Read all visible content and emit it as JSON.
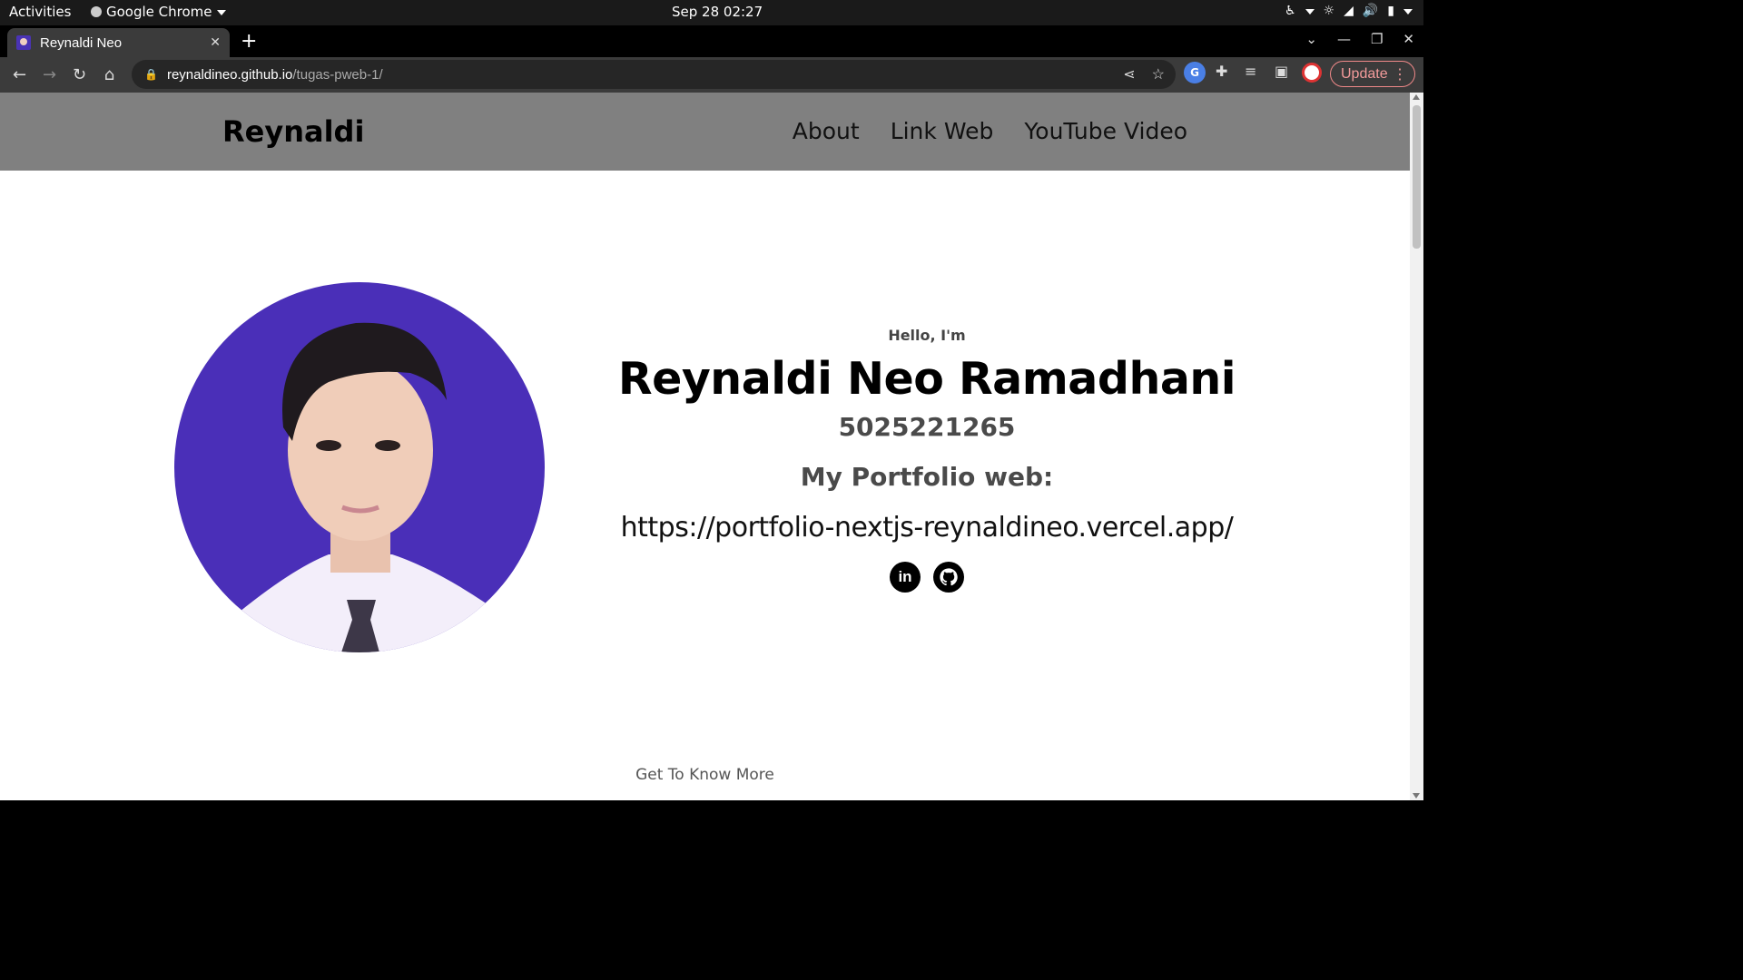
{
  "system_bar": {
    "activities": "Activities",
    "app_name": "Google Chrome",
    "clock": "Sep 28  02:27"
  },
  "browser": {
    "tab_title": "Reynaldi Neo",
    "url_host": "reynaldineo.github.io",
    "url_path": "/tugas-pweb-1/",
    "update_label": "Update"
  },
  "site": {
    "logo": "Reynaldi",
    "nav_links": [
      "About",
      "Link Web",
      "YouTube Video"
    ],
    "greeting": "Hello, I'm",
    "name": "Reynaldi Neo Ramadhani",
    "student_id": "5025221265",
    "portfolio_label": "My Portfolio web:",
    "portfolio_url": "https://portfolio-nextjs-reynaldineo.vercel.app/",
    "socials": [
      {
        "icon": "linkedin-icon",
        "glyph": "in"
      },
      {
        "icon": "github-icon",
        "glyph": ""
      }
    ],
    "section_hint": "Get To Know More"
  },
  "colors": {
    "nav_bg": "#808080",
    "photo_bg": "#4a2fb8",
    "update_accent": "#f49b9b"
  }
}
